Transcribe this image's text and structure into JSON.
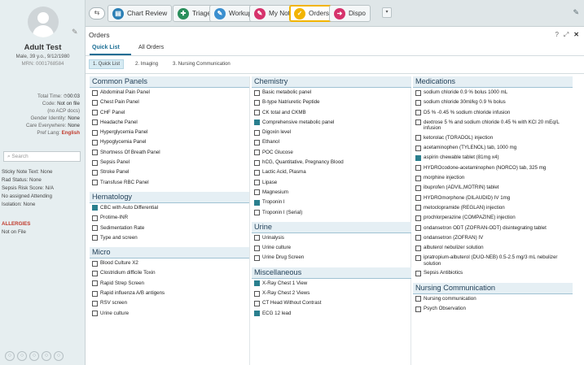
{
  "patient": {
    "name": "Adult Test",
    "demographics": "Male, 39 y.o., 9/12/1980",
    "mrn": "MRN: 0001768584",
    "total_time_label": "Total Time:",
    "total_time_value": "00:03",
    "code_label": "Code:",
    "code_value": "Not on file",
    "code_sub": "(no ACP docs)",
    "gender_label": "Gender Identity:",
    "gender_value": "None",
    "care_label": "Care Everywhere:",
    "care_value": "None",
    "lang_label": "Pref Lang:",
    "lang_value": "English",
    "search_placeholder": "Search",
    "sticky_note": "Sticky Note Text: None",
    "rad_status": "Rad Status: None",
    "sepsis": "Sepsis Risk Score: N/A",
    "attending": "No assigned Attending",
    "isolation": "Isolation: None",
    "allergies_title": "ALLERGIES",
    "allergies_value": "Not on File"
  },
  "tabs": [
    {
      "label": "Chart Review",
      "icon": "chart-review-icon",
      "color": "#2b7fb5"
    },
    {
      "label": "Triage",
      "icon": "triage-icon",
      "color": "#2a8f5c"
    },
    {
      "label": "Workup",
      "icon": "workup-icon",
      "color": "#3a8fcf"
    },
    {
      "label": "My Note",
      "icon": "my-note-icon",
      "color": "#d6336c"
    },
    {
      "label": "Orders",
      "icon": "orders-icon",
      "color": "#f2b400"
    },
    {
      "label": "Dispo",
      "icon": "dispo-icon",
      "color": "#d6336c"
    }
  ],
  "orders": {
    "title": "Orders",
    "subtabs": [
      "Quick List",
      "All Orders"
    ],
    "categories": [
      "1. Quick List",
      "2. Imaging",
      "3. Nursing Communication"
    ],
    "controls": {
      "help": "?",
      "expand": "⤢",
      "close": "✕"
    }
  },
  "sections": {
    "common_panels": {
      "title": "Common Panels",
      "items": [
        {
          "label": "Abdominal Pain Panel",
          "checked": false
        },
        {
          "label": "Chest Pain Panel",
          "checked": false
        },
        {
          "label": "CHF Panel",
          "checked": false
        },
        {
          "label": "Headache Panel",
          "checked": false
        },
        {
          "label": "Hyperglycemia Panel",
          "checked": false
        },
        {
          "label": "Hypoglycemia Panel",
          "checked": false
        },
        {
          "label": "Shortness Of Breath Panel",
          "checked": false
        },
        {
          "label": "Sepsis Panel",
          "checked": false
        },
        {
          "label": "Stroke Panel",
          "checked": false
        },
        {
          "label": "Transfuse RBC Panel",
          "checked": false
        }
      ]
    },
    "hematology": {
      "title": "Hematology",
      "items": [
        {
          "label": "CBC with Auto Differential",
          "checked": true
        },
        {
          "label": "Protime-INR",
          "checked": false
        },
        {
          "label": "Sedimentation Rate",
          "checked": false
        },
        {
          "label": "Type and screen",
          "checked": false
        }
      ]
    },
    "micro": {
      "title": "Micro",
      "items": [
        {
          "label": "Blood Culture X2",
          "checked": false
        },
        {
          "label": "Clostridium difficile Toxin",
          "checked": false
        },
        {
          "label": "Rapid Strep Screen",
          "checked": false
        },
        {
          "label": "Rapid influenza A/B antigens",
          "checked": false
        },
        {
          "label": "RSV screen",
          "checked": false
        },
        {
          "label": "Urine culture",
          "checked": false
        }
      ]
    },
    "chemistry": {
      "title": "Chemistry",
      "items": [
        {
          "label": "Basic metabolic panel",
          "checked": false
        },
        {
          "label": "B-type Natriuretic Peptide",
          "checked": false
        },
        {
          "label": "CK total and CKMB",
          "checked": false
        },
        {
          "label": "Comprehensive metabolic panel",
          "checked": true
        },
        {
          "label": "Digoxin level",
          "checked": false
        },
        {
          "label": "Ethanol",
          "checked": false
        },
        {
          "label": "POC Glucose",
          "checked": false
        },
        {
          "label": "hCG, Quantitative, Pregnancy Blood",
          "checked": false
        },
        {
          "label": "Lactic Acid, Plasma",
          "checked": false
        },
        {
          "label": "Lipase",
          "checked": false
        },
        {
          "label": "Magnesium",
          "checked": false
        },
        {
          "label": "Troponin I",
          "checked": true
        },
        {
          "label": "Troponin I (Serial)",
          "checked": false
        }
      ]
    },
    "urine": {
      "title": "Urine",
      "items": [
        {
          "label": "Urinalysis",
          "checked": false
        },
        {
          "label": "Urine culture",
          "checked": false
        },
        {
          "label": "Urine Drug Screen",
          "checked": false
        }
      ]
    },
    "miscellaneous": {
      "title": "Miscellaneous",
      "items": [
        {
          "label": "X-Ray Chest 1 View",
          "checked": true
        },
        {
          "label": "X-Ray Chest 2 Views",
          "checked": false
        },
        {
          "label": "CT Head Without Contrast",
          "checked": false
        },
        {
          "label": "ECG 12 lead",
          "checked": true
        }
      ]
    },
    "medications": {
      "title": "Medications",
      "items": [
        {
          "label": "sodium chloride 0.9 % bolus 1000 mL",
          "checked": false
        },
        {
          "label": "sodium chloride 30ml/kg 0.9 % bolus",
          "checked": false
        },
        {
          "label": "D5 % -0.45 % sodium chloride infusion",
          "checked": false
        },
        {
          "label": "dextrose 5 % and sodium chloride 0.45 % with KCl 20 mEq/L infusion",
          "checked": false,
          "tall": true
        },
        {
          "label": "ketorolac (TORADOL) injection",
          "checked": false
        },
        {
          "label": "acetaminophen (TYLENOL) tab, 1000 mg",
          "checked": false
        },
        {
          "label": "aspirin chewable tablet (81mg x4)",
          "checked": true
        },
        {
          "label": "HYDROcodone-acetaminophen (NORCO) tab, 325 mg",
          "checked": false
        },
        {
          "label": "morphine injection",
          "checked": false
        },
        {
          "label": "ibuprofen (ADVIL,MOTRIN) tablet",
          "checked": false
        },
        {
          "label": "HYDROmorphone (DILAUDID) IV 1mg",
          "checked": false
        },
        {
          "label": "metoclopramide (REGLAN) injection",
          "checked": false
        },
        {
          "label": "prochlorperazine (COMPAZINE) injection",
          "checked": false
        },
        {
          "label": "ondansetron ODT (ZOFRAN-ODT) disintegrating tablet",
          "checked": false
        },
        {
          "label": "ondansetron (ZOFRAN) IV",
          "checked": false
        },
        {
          "label": "albuterol nebulizer solution",
          "checked": false
        },
        {
          "label": "ipratropium-albuterol (DUO-NEB) 0.5-2.5 mg/3 mL nebulizer solution",
          "checked": false,
          "tall": true
        },
        {
          "label": "Sepsis Antibiotics",
          "checked": false
        }
      ]
    },
    "nursing_communication": {
      "title": "Nursing Communication",
      "items": [
        {
          "label": "Nursing communication",
          "checked": false
        },
        {
          "label": "Psych Observation",
          "checked": false
        }
      ]
    }
  },
  "columns": [
    [
      "common_panels",
      "hematology",
      "micro"
    ],
    [
      "chemistry",
      "urine",
      "miscellaneous"
    ],
    [
      "medications",
      "nursing_communication"
    ]
  ]
}
